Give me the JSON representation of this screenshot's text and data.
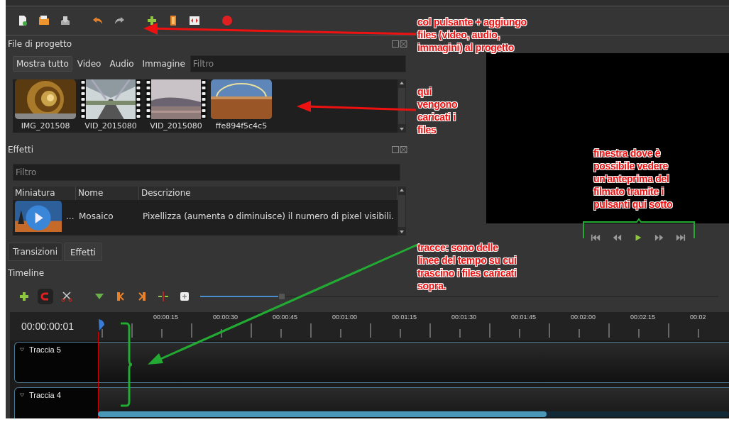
{
  "project_files": {
    "title": "File di progetto",
    "filters": [
      {
        "label": "Mostra tutto",
        "selected": true
      },
      {
        "label": "Video",
        "selected": false
      },
      {
        "label": "Audio",
        "selected": false
      },
      {
        "label": "Immagine",
        "selected": false
      }
    ],
    "filter_placeholder": "Filtro",
    "files": [
      {
        "name": "IMG_201508"
      },
      {
        "name": "VID_2015080",
        "kind": "video"
      },
      {
        "name": "VID_2015080",
        "kind": "video"
      },
      {
        "name": "ffe894f5c4c5"
      }
    ]
  },
  "effects": {
    "title": "Effetti",
    "filter_placeholder": "Filtro",
    "columns": [
      "Miniatura",
      "Nome",
      "Descrizione"
    ],
    "rows": [
      {
        "more": "...",
        "name": "Mosaico",
        "description": "Pixellizza (aumenta o diminuisce) il numero di pixel visibili."
      }
    ]
  },
  "dock_tabs": [
    {
      "label": "Transizioni",
      "selected": false
    },
    {
      "label": "Effetti",
      "selected": true
    }
  ],
  "timeline": {
    "title": "Timeline",
    "time": "00:00:00:01",
    "zoom": {
      "level": 0.15
    },
    "ruler": [
      "00:00:15",
      "00:00:30",
      "00:00:45",
      "00:01:00",
      "00:01:15",
      "00:01:30",
      "00:01:45",
      "00:02:00",
      "00:02:15",
      "00:02"
    ],
    "tracks": [
      {
        "name": "Traccia 5"
      },
      {
        "name": "Traccia 4"
      }
    ]
  },
  "annotations": [
    {
      "text": "col pulsante + aggiungo files (video, audio, immagini) al progetto",
      "color": "#ee1111"
    },
    {
      "text": "qui vengono caricati i files",
      "color": "#ee1111"
    },
    {
      "text": "finestra dove è possibile vedere un'anteprima del filmato tramite i pulsanti qui sotto",
      "color": "#ee1111"
    },
    {
      "text": "tracce: sono delle linee del tempo su cui trascino i files caricati sopra.",
      "color": "#ee1111"
    }
  ]
}
